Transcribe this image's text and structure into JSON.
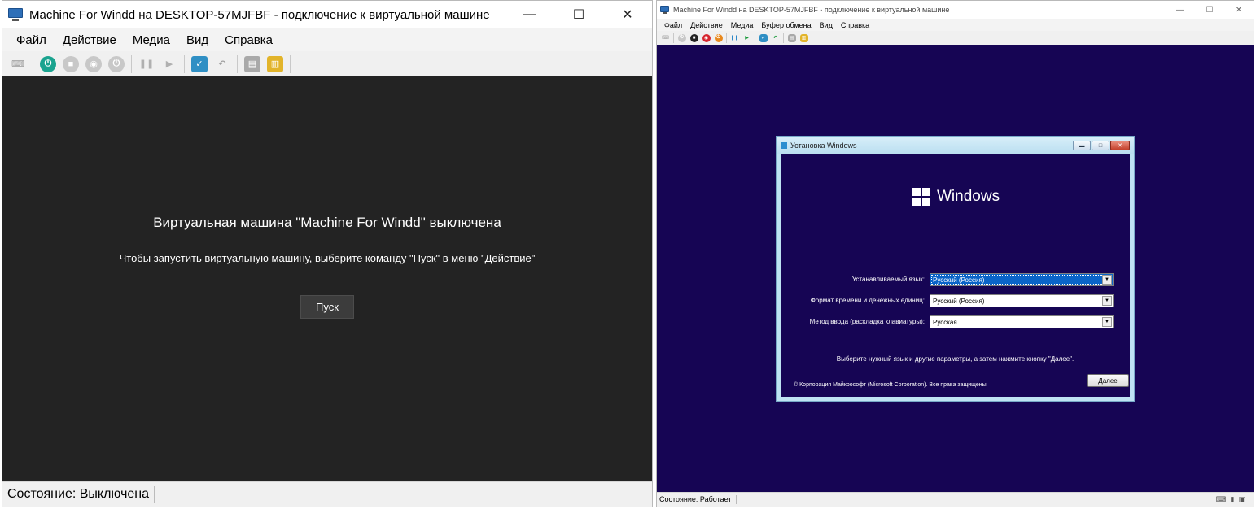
{
  "left_window": {
    "title": "Machine For Windd на DESKTOP-57MJFBF - подключение к виртуальной машине",
    "controls": {
      "minimize": "—",
      "maximize": "☐",
      "close": "✕"
    },
    "menu": [
      "Файл",
      "Действие",
      "Медиа",
      "Вид",
      "Справка"
    ],
    "toolbar_icons": [
      "ctrl-alt-del-icon",
      "start-icon",
      "turn-off-icon",
      "shutdown-icon",
      "save-icon",
      "pause-icon",
      "reset-icon",
      "checkpoint-icon",
      "revert-icon",
      "enhanced-session-icon",
      "share-icon"
    ],
    "screen": {
      "heading": "Виртуальная машина \"Machine For Windd\" выключена",
      "hint": "Чтобы запустить виртуальную машину, выберите команду \"Пуск\" в меню \"Действие\"",
      "start_button": "Пуск"
    },
    "status": "Состояние: Выключена"
  },
  "right_window": {
    "title": "Machine For Windd на DESKTOP-57MJFBF - подключение к виртуальной машине",
    "controls": {
      "minimize": "—",
      "maximize": "☐",
      "close": "✕"
    },
    "menu": [
      "Файл",
      "Действие",
      "Медиа",
      "Буфер обмена",
      "Вид",
      "Справка"
    ],
    "setup_dialog": {
      "title": "Установка Windows",
      "logo_text": "Windows",
      "fields": [
        {
          "label": "Устанавливаемый язык:",
          "value": "Русский (Россия)"
        },
        {
          "label": "Формат времени и денежных единиц:",
          "value": "Русский (Россия)"
        },
        {
          "label": "Метод ввода (раскладка клавиатуры):",
          "value": "Русская"
        }
      ],
      "hint": "Выберите нужный язык и другие параметры, а затем нажмите кнопку \"Далее\".",
      "copyright": "© Корпорация Майкрософт (Microsoft Corporation). Все права защищены.",
      "next_button": "Далее"
    },
    "status": "Состояние: Работает",
    "colors": {
      "screen_bg": "#160554",
      "select_highlight": "#0a64c8"
    }
  }
}
